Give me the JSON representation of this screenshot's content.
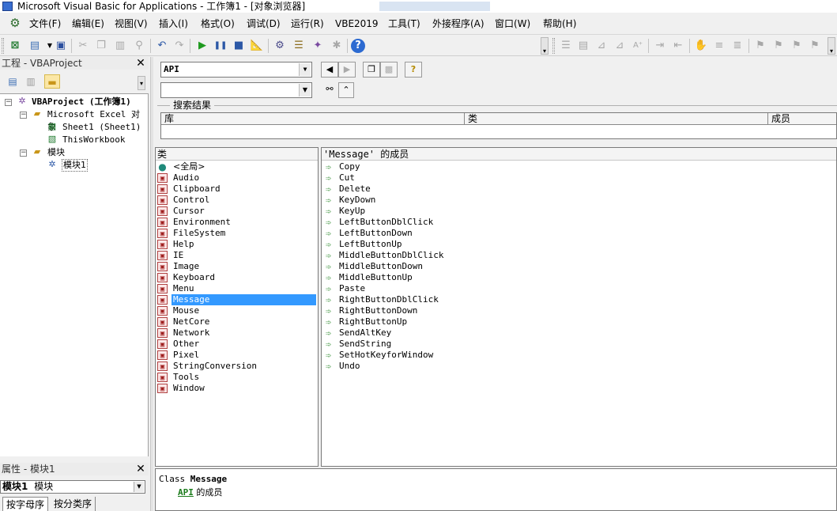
{
  "window": {
    "title": "Microsoft Visual Basic for Applications - 工作簿1 - [对象浏览器]"
  },
  "menubar": {
    "icon": "vba-app-icon",
    "items": [
      "文件(F)",
      "编辑(E)",
      "视图(V)",
      "插入(I)",
      "格式(O)",
      "调试(D)",
      "运行(R)",
      "VBE2019",
      "工具(T)",
      "外接程序(A)",
      "窗口(W)",
      "帮助(H)"
    ]
  },
  "toolbar": {
    "icons": [
      "excel-view-icon",
      "insert-userform-icon",
      "save-icon",
      "cut-icon",
      "copy-icon",
      "paste-icon",
      "find-icon",
      "undo-icon",
      "redo-icon",
      "run-icon",
      "break-icon",
      "reset-icon",
      "design-mode-icon",
      "project-explorer-icon",
      "properties-window-icon",
      "object-browser-icon",
      "toolbox-icon",
      "help-icon"
    ]
  },
  "project_pane": {
    "title": "工程 - VBAProject",
    "tree": [
      {
        "label": "VBAProject (工作簿1)",
        "kind": "project",
        "expanded": true
      },
      {
        "label": "Microsoft Excel 对象",
        "kind": "folder",
        "expanded": true
      },
      {
        "label": "Sheet1 (Sheet1)",
        "kind": "sheet"
      },
      {
        "label": "ThisWorkbook",
        "kind": "workbook"
      },
      {
        "label": "模块",
        "kind": "folder",
        "expanded": true
      },
      {
        "label": "模块1",
        "kind": "module",
        "selected": true
      }
    ]
  },
  "properties_pane": {
    "title": "属性 - 模块1",
    "object_bold": "模块1",
    "object_type": "模块",
    "tabs": [
      "按字母序",
      "按分类序"
    ]
  },
  "object_browser": {
    "library": "API",
    "search_text": "",
    "search_results": {
      "legend": "搜索结果",
      "columns": [
        "库",
        "类",
        "成员"
      ]
    },
    "classes_header": "类",
    "classes": [
      "<全局>",
      "Audio",
      "Clipboard",
      "Control",
      "Cursor",
      "Environment",
      "FileSystem",
      "Help",
      "IE",
      "Image",
      "Keyboard",
      "Menu",
      "Message",
      "Mouse",
      "NetCore",
      "Network",
      "Other",
      "Pixel",
      "StringConversion",
      "Tools",
      "Window"
    ],
    "selected_class": "Message",
    "members_header": "'Message' 的成员",
    "members": [
      "Copy",
      "Cut",
      "Delete",
      "KeyDown",
      "KeyUp",
      "LeftButtonDblClick",
      "LeftButtonDown",
      "LeftButtonUp",
      "MiddleButtonDblClick",
      "MiddleButtonDown",
      "MiddleButtonUp",
      "Paste",
      "RightButtonDblClick",
      "RightButtonDown",
      "RightButtonUp",
      "SendAltKey",
      "SendString",
      "SetHotKeyforWindow",
      "Undo"
    ],
    "details": {
      "kind": "Class",
      "name": "Message",
      "member_of_link": "API",
      "member_of_text": "的成员"
    }
  },
  "colors": {
    "selection": "#3399ff",
    "link": "#1b7b1b",
    "window_bg": "#f0f0f0"
  }
}
